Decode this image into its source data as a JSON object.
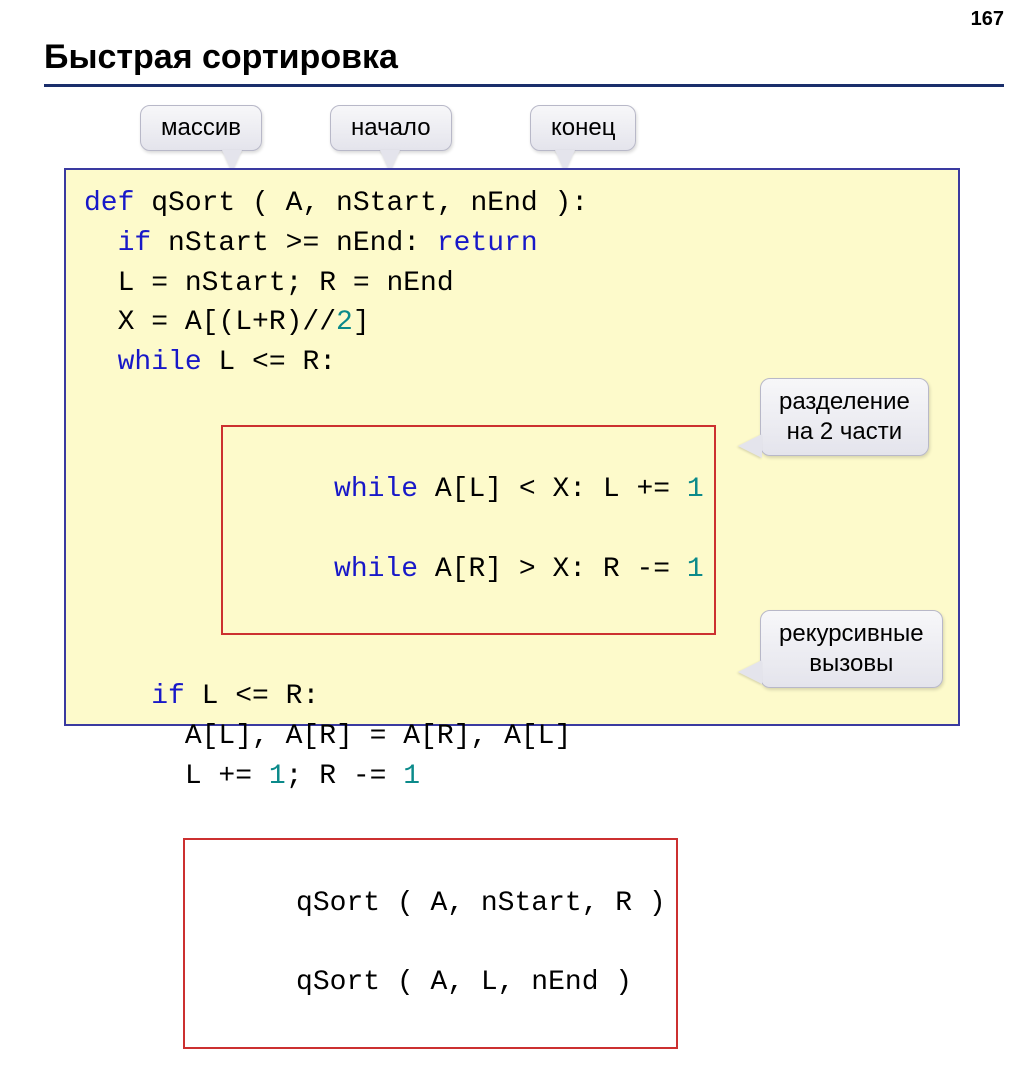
{
  "page_number": "167",
  "title": "Быстрая сортировка",
  "labels": {
    "array": "массив",
    "start": "начало",
    "end": "конец"
  },
  "callouts": {
    "split_line1": "разделение",
    "split_line2": "на 2 части",
    "recursive_line1": "рекурсивные",
    "recursive_line2": "вызовы"
  },
  "code": {
    "l1_def": "def",
    "l1_rest": " qSort ( A, nStart, nEnd ):",
    "l2_pre": "  ",
    "l2_if": "if",
    "l2_mid": " nStart >= nEnd: ",
    "l2_ret": "return",
    "l3": "  L = nStart; R = nEnd",
    "l4_pre": "  X = A[(L+R)//",
    "l4_num": "2",
    "l4_post": "]",
    "l5_pre": "  ",
    "l5_while": "while",
    "l5_post": " L <= R:",
    "l6_while": "while",
    "l6_mid": " A[L] < X: L += ",
    "l6_num": "1",
    "l7_while": "while",
    "l7_mid": " A[R] > X: R -= ",
    "l7_num": "1",
    "l8_pre": "    ",
    "l8_if": "if",
    "l8_post": " L <= R:",
    "l9": "      A[L], A[R] = A[R], A[L]",
    "l10_pre": "      L += ",
    "l10_n1": "1",
    "l10_mid": "; R -= ",
    "l10_n2": "1",
    "l11": "qSort ( A, nStart, R )",
    "l12": "qSort ( A, L, nEnd )"
  }
}
